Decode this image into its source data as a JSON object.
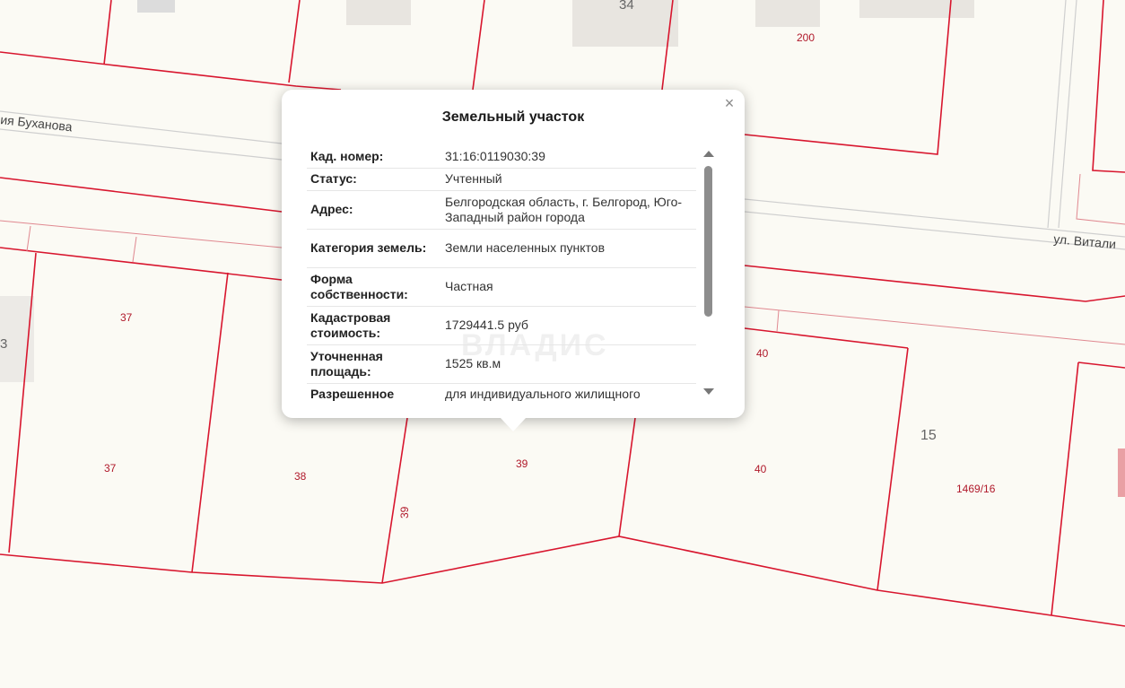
{
  "map": {
    "streets": [
      "ия Буханова",
      "ул. Витали"
    ],
    "house_numbers": [
      "34",
      "15",
      "3"
    ],
    "plot_labels": [
      "200",
      "37",
      "37",
      "38",
      "39",
      "39",
      "40",
      "40",
      "1469/16"
    ]
  },
  "popup": {
    "title": "Земельный участок",
    "close_label": "×",
    "watermark": "ВЛАДИС",
    "rows": [
      {
        "key": "Кад. номер:",
        "value": "31:16:0119030:39"
      },
      {
        "key": "Статус:",
        "value": "Учтенный"
      },
      {
        "key": "Адрес:",
        "value": "Белгородская область, г. Белгород, Юго-Западный район города"
      },
      {
        "key": "Категория земель:",
        "value": "Земли населенных пунктов"
      },
      {
        "key": "Форма собственности:",
        "value": "Частная"
      },
      {
        "key": "Кадастровая стоимость:",
        "value": "1729441.5 руб"
      },
      {
        "key": "Уточненная площадь:",
        "value": "1525 кв.м"
      },
      {
        "key": "Разрешенное",
        "value": "для индивидуального жилищного"
      }
    ]
  },
  "colors": {
    "boundary": "#d8162e",
    "background": "#fbfaf4",
    "building": "#e9e6e1"
  }
}
